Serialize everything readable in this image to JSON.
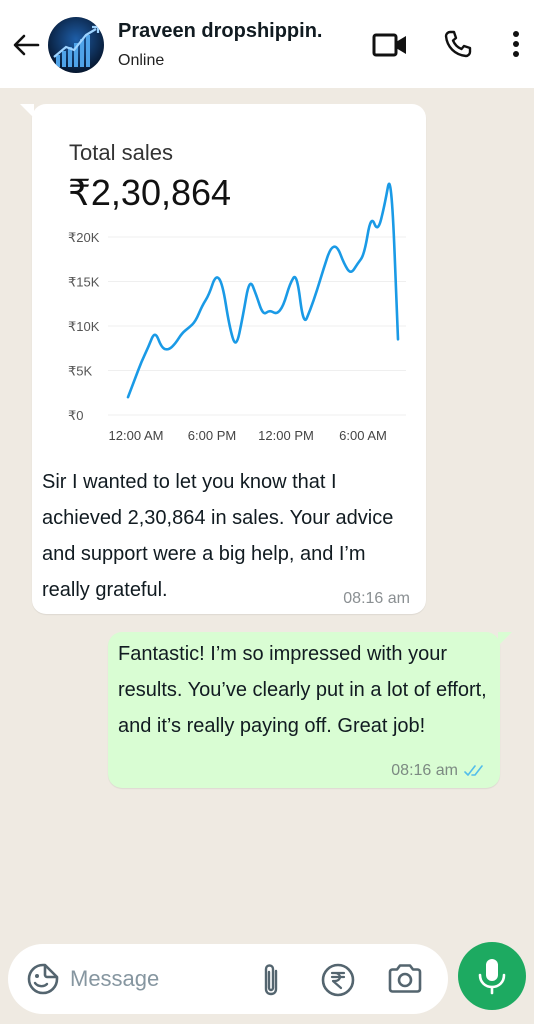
{
  "header": {
    "contact_name": "Praveen dropshippin.",
    "status": "Online"
  },
  "chart_card": {
    "title": "Total sales",
    "total": "₹2,30,864"
  },
  "chart_data": {
    "type": "line",
    "title": "Total sales",
    "y_tick_labels": [
      "₹20K",
      "₹15K",
      "₹10K",
      "₹5K",
      "₹0"
    ],
    "x_tick_labels": [
      "12:00 AM",
      "6:00 PM",
      "12:00 PM",
      "6:00 AM"
    ],
    "ylim": [
      0,
      20000
    ],
    "grid": true,
    "series": [
      {
        "values": [
          2000,
          4000,
          6000,
          7600,
          9500,
          7500,
          7300,
          8000,
          9200,
          9800,
          10500,
          12300,
          13500,
          15800,
          14800,
          10000,
          7400,
          11000,
          15400,
          13500,
          11200,
          11800,
          11300,
          12200,
          14800,
          16000,
          10000,
          11800,
          14000,
          16500,
          18800,
          19000,
          17000,
          15800,
          17000,
          18000,
          22500,
          20500,
          23500,
          27700,
          8500
        ]
      }
    ],
    "color": "#1a9ae6"
  },
  "messages": {
    "incoming": {
      "text": " Sir I wanted to let you know that I achieved 2,30,864 in sales. Your advice and support were a big help, and I’m really grateful.",
      "time": "08:16 am"
    },
    "outgoing": {
      "text": " Fantastic! I’m so impressed with your results. You’ve clearly put in a lot of effort, and it’s really paying off. Great job!",
      "time": "08:16 am"
    }
  },
  "composer": {
    "placeholder": "Message"
  },
  "colors": {
    "wallpaper": "#efeae2",
    "outgoing_bubble": "#d9fdd3",
    "mic_button": "#1daa61",
    "read_ticks": "#53bdeb"
  },
  "icons": [
    "back-arrow-icon",
    "avatar",
    "video-call-icon",
    "phone-icon",
    "more-vertical-icon",
    "sticker-icon",
    "paperclip-icon",
    "rupee-icon",
    "camera-icon",
    "mic-icon",
    "double-check-icon"
  ]
}
